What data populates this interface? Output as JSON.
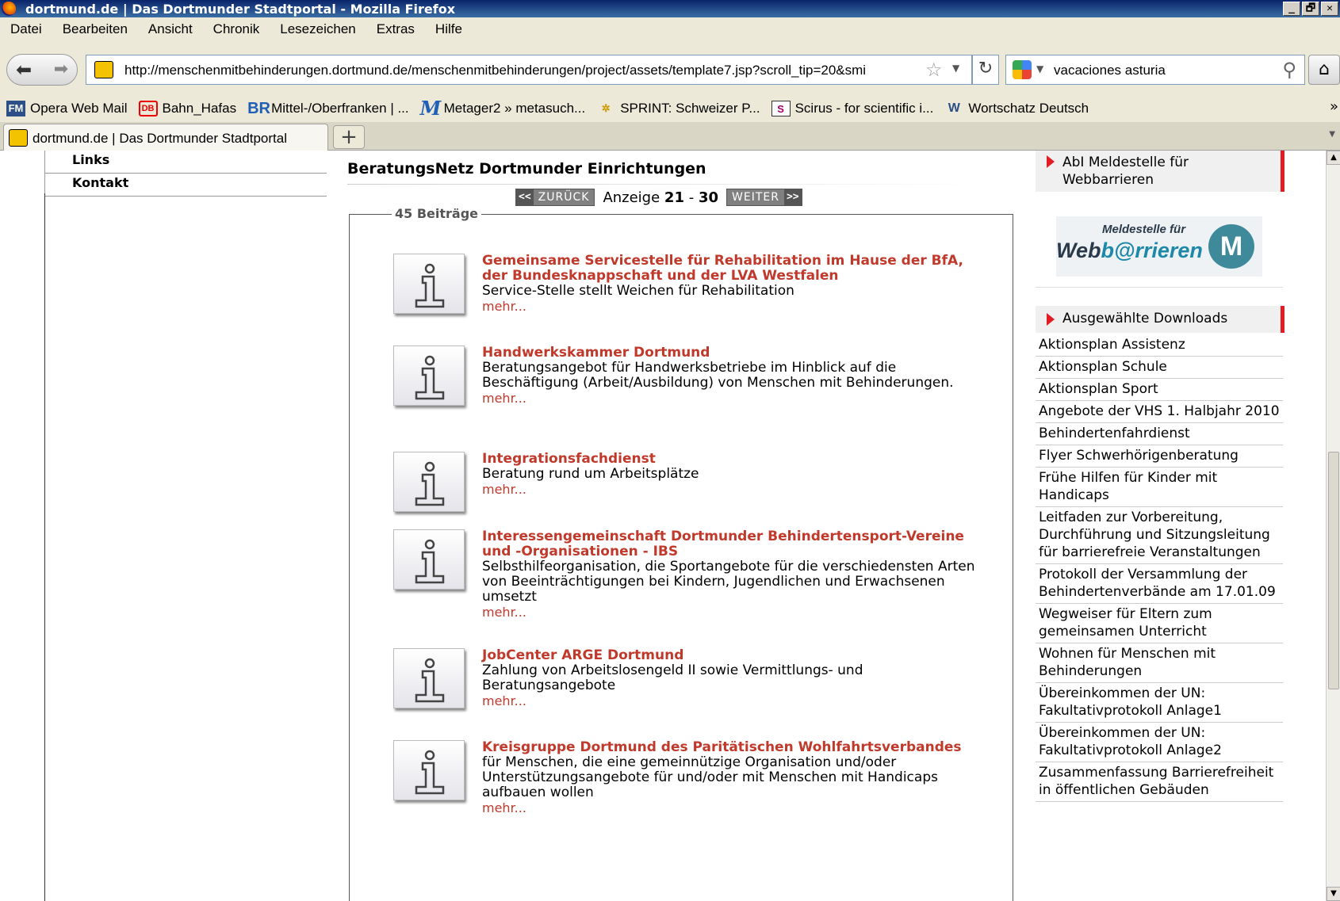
{
  "window": {
    "title": "dortmund.de | Das Dortmunder Stadtportal - Mozilla Firefox",
    "controls": [
      "_",
      "🗗",
      "✕"
    ]
  },
  "menu": [
    "Datei",
    "Bearbeiten",
    "Ansicht",
    "Chronik",
    "Lesezeichen",
    "Extras",
    "Hilfe"
  ],
  "nav": {
    "url": "http://menschenmitbehinderungen.dortmund.de/menschenmitbehinderungen/project/assets/template7.jsp?scroll_tip=20&smi",
    "search_query": "vacaciones asturia"
  },
  "bookmarks": [
    {
      "label": "Opera Web Mail",
      "icon": "FM"
    },
    {
      "label": "Bahn_Hafas",
      "icon": "DB"
    },
    {
      "label": "Mittel-/Oberfranken | ...",
      "icon": "BR"
    },
    {
      "label": "Metager2 » metasuch...",
      "icon": "M"
    },
    {
      "label": "SPRINT: Schweizer P...",
      "icon": "✲"
    },
    {
      "label": "Scirus - for scientific i...",
      "icon": "S"
    },
    {
      "label": "Wortschatz Deutsch",
      "icon": "W"
    }
  ],
  "tab": {
    "label": "dortmund.de | Das Dortmunder Stadtportal",
    "new_tab": "+"
  },
  "leftnav": [
    "Links",
    "Kontakt"
  ],
  "main": {
    "heading": "BeratungsNetz Dortmunder Einrichtungen",
    "pager": {
      "prev_arrow": "<<",
      "prev": "ZURÜCK",
      "display_prefix": "Anzeige",
      "from": "21",
      "sep": "-",
      "to": "30",
      "next": "WEITER",
      "next_arrow": ">>"
    },
    "count_label": "45 Beiträge",
    "entries": [
      {
        "title": "Gemeinsame Servicestelle für Rehabilitation im Hause der BfA, der Bundesknappschaft und der LVA Westfalen",
        "desc": "Service-Stelle stellt Weichen für Rehabilitation",
        "more": "mehr..."
      },
      {
        "title": "Handwerkskammer Dortmund",
        "desc": "Beratungsangebot für Handwerksbetriebe im Hinblick auf die Beschäftigung (Arbeit/Ausbildung) von Menschen mit Behinderungen.",
        "more": "mehr..."
      },
      {
        "title": "Integrationsfachdienst",
        "desc": "Beratung rund um Arbeitsplätze",
        "more": "mehr..."
      },
      {
        "title": "Interessengemeinschaft Dortmunder Behindertensport-Vereine und -Organisationen - IBS",
        "desc": "Selbsthilfeorganisation, die Sportangebote für die verschiedensten Arten von Beeinträchtigungen bei Kindern, Jugendlichen und Erwachsenen umsetzt",
        "more": "mehr..."
      },
      {
        "title": "JobCenter ARGE Dortmund",
        "desc": "Zahlung von Arbeitslosengeld II sowie Vermittlungs- und Beratungsangebote",
        "more": "mehr..."
      },
      {
        "title": "Kreisgruppe Dortmund des Paritätischen Wohlfahrtsverbandes",
        "desc": "für Menschen, die eine gemeinnützige Organisation und/oder Unterstützungsangebote für und/oder mit Menschen mit Handicaps aufbauen wollen",
        "more": "mehr..."
      }
    ]
  },
  "right": {
    "meldestelle_link": "AbI Meldestelle für Webbarrieren",
    "logo": {
      "small": "Meldestelle für",
      "big_a": "Web",
      "big_b": "b@rrieren",
      "badge": "M"
    },
    "downloads_heading": "Ausgewählte Downloads",
    "downloads": [
      "Aktionsplan Assistenz",
      "Aktionsplan Schule",
      "Aktionsplan Sport",
      "Angebote der VHS 1. Halbjahr 2010",
      "Behindertenfahrdienst",
      "Flyer Schwerhörigenberatung",
      "Frühe Hilfen für Kinder mit Handicaps",
      "Leitfaden zur Vorbereitung, Durchführung und Sitzungsleitung für barrierefreie Veranstaltungen",
      "Protokoll der Versammlung der Behindertenverbände am 17.01.09",
      "Wegweiser für Eltern zum gemeinsamen Unterricht",
      "Wohnen für Menschen mit Behinderungen",
      "Übereinkommen der UN: Fakultativprotokoll Anlage1",
      "Übereinkommen der UN: Fakultativprotokoll Anlage2",
      "Zusammenfassung Barrierefreiheit in öffentlichen Gebäuden"
    ]
  }
}
